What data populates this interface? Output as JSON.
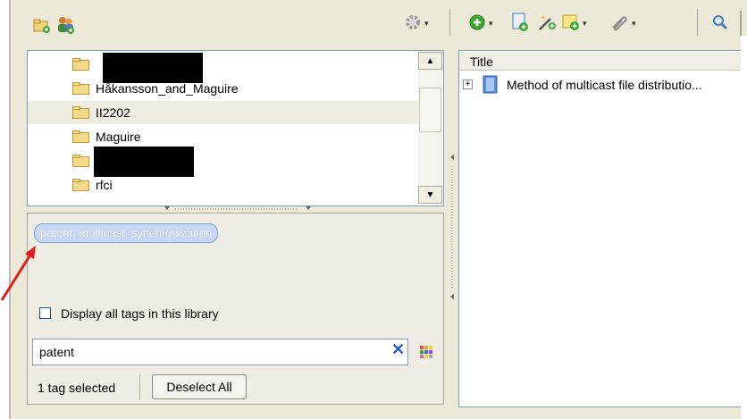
{
  "toolbar": {
    "left_icons": [
      "new-collection-icon",
      "new-group-icon"
    ],
    "right_icons": [
      "gear-icon",
      "new-item-icon",
      "new-note-page-icon",
      "magic-wand-icon",
      "add-note-icon",
      "attachment-icon",
      "search-icon"
    ],
    "colors": {
      "green": "#3da832",
      "blue": "#2f6fc9",
      "yellow": "#f0c43a"
    }
  },
  "collections": {
    "items": [
      {
        "label": "",
        "redacted": true
      },
      {
        "label": "Håkansson_and_Maguire"
      },
      {
        "label": "II2202",
        "selected": true
      },
      {
        "label": "Maguire"
      },
      {
        "label": "",
        "redacted": true
      },
      {
        "label": "rfci"
      }
    ]
  },
  "tags": {
    "selected_tag": "patent, multicast, synchronization",
    "display_all_label": "Display all tags in this library",
    "display_all_checked": false,
    "filter_value": "patent",
    "selected_count": "1 tag selected",
    "deselect_label": "Deselect All"
  },
  "items_pane": {
    "column_title": "Title",
    "rows": [
      {
        "title": "Method of multicast file distributio..."
      }
    ]
  },
  "annotation": {
    "arrow_color": "#e21b1b"
  }
}
